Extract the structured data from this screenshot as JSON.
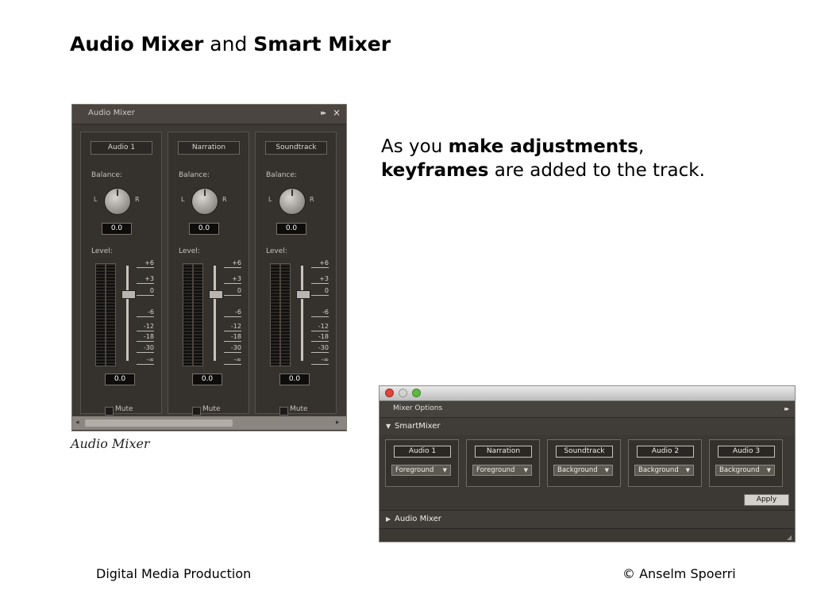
{
  "slide": {
    "title": {
      "part1": "Audio Mixer",
      "part2": " and ",
      "part3": "Smart Mixer"
    },
    "body": {
      "line1_prefix": "As you ",
      "line1_bold": "make adjustments",
      "line1_suffix": ",",
      "line2_bold": "keyframes",
      "line2_suffix": " are added to the track."
    },
    "footer_left": "Digital Media Production",
    "footer_right": "© Anselm Spoerri"
  },
  "audio_mixer": {
    "panel_title": "Audio Mixer",
    "menu_icon": "panel-menu-icon",
    "close_icon": "close-icon",
    "caption": "Audio Mixer",
    "channels": [
      {
        "name": "Audio 1",
        "balance_label": "Balance:",
        "left": "L",
        "right": "R",
        "balance_value": "0.0",
        "level_label": "Level:",
        "level_value": "0.0",
        "mute_label": "Mute",
        "scale": [
          "+6",
          "+3",
          "0",
          "-6",
          "-12",
          "-18",
          "-30",
          "-∞"
        ]
      },
      {
        "name": "Narration",
        "balance_label": "Balance:",
        "left": "L",
        "right": "R",
        "balance_value": "0.0",
        "level_label": "Level:",
        "level_value": "0.0",
        "mute_label": "Mute",
        "scale": [
          "+6",
          "+3",
          "0",
          "-6",
          "-12",
          "-18",
          "-30",
          "-∞"
        ]
      },
      {
        "name": "Soundtrack",
        "balance_label": "Balance:",
        "left": "L",
        "right": "R",
        "balance_value": "0.0",
        "level_label": "Level:",
        "level_value": "0.0",
        "mute_label": "Mute",
        "scale": [
          "+6",
          "+3",
          "0",
          "-6",
          "-12",
          "-18",
          "-30",
          "-∞"
        ]
      }
    ]
  },
  "smart_mixer": {
    "menu_label": "Mixer Options",
    "section_label": "SmartMixer",
    "tracks": [
      {
        "name": "Audio 1",
        "mode": "Foreground"
      },
      {
        "name": "Narration",
        "mode": "Foreground"
      },
      {
        "name": "Soundtrack",
        "mode": "Background"
      },
      {
        "name": "Audio 2",
        "mode": "Background"
      },
      {
        "name": "Audio 3",
        "mode": "Background"
      }
    ],
    "apply_label": "Apply",
    "collapsed_section_label": "Audio Mixer"
  }
}
